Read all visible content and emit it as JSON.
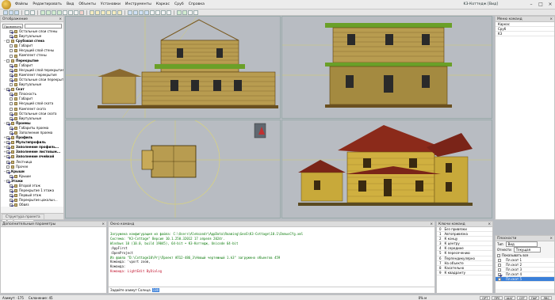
{
  "app": {
    "menu": [
      "Файлы",
      "Редактировать",
      "Вид",
      "Объекты",
      "Установки",
      "Инструменты",
      "Каркас",
      "Сруб",
      "Справка"
    ],
    "doc_title": "K3-Коттедж [Вид]"
  },
  "left_panel": {
    "title": "Отображение",
    "tabs": [
      "Структура проекта",
      "Отображение"
    ],
    "preset": "Применить",
    "tree": [
      {
        "label": "Остальные слои стены",
        "check": true,
        "indent": 2,
        "icon": true
      },
      {
        "label": "Виртуальные",
        "check": true,
        "indent": 2,
        "icon": true
      },
      {
        "label": "Срубовая стена",
        "check": false,
        "indent": 1,
        "icon": true,
        "bold": true,
        "exp": "−"
      },
      {
        "label": "Габарит",
        "check": false,
        "indent": 2,
        "icon": true
      },
      {
        "label": "Несущий слой стены",
        "check": false,
        "indent": 2,
        "icon": true
      },
      {
        "label": "Комплект стены",
        "check": false,
        "indent": 2,
        "icon": true
      },
      {
        "label": "Перекрытие",
        "check": false,
        "indent": 1,
        "icon": true,
        "bold": true,
        "exp": "−"
      },
      {
        "label": "Габарит",
        "check": true,
        "indent": 2,
        "icon": true
      },
      {
        "label": "Несущий слой перекрытия",
        "check": true,
        "indent": 2,
        "icon": true
      },
      {
        "label": "Комплект перекрытия",
        "check": true,
        "indent": 2,
        "icon": true
      },
      {
        "label": "Остальные слои перекрытия",
        "check": true,
        "indent": 2,
        "icon": true
      },
      {
        "label": "Виртуальные",
        "check": false,
        "indent": 2,
        "icon": true
      },
      {
        "label": "Скат",
        "check": true,
        "indent": 1,
        "icon": true,
        "bold": true,
        "exp": "−"
      },
      {
        "label": "Плоскость",
        "check": true,
        "indent": 2,
        "icon": true
      },
      {
        "label": "Габарит",
        "check": false,
        "indent": 2,
        "icon": true
      },
      {
        "label": "Несущий слой ската",
        "check": false,
        "indent": 2,
        "icon": true
      },
      {
        "label": "Комплект ската",
        "check": false,
        "indent": 2,
        "icon": true
      },
      {
        "label": "Остальные слои ската",
        "check": true,
        "indent": 2,
        "icon": true
      },
      {
        "label": "Виртуальные",
        "check": true,
        "indent": 2,
        "icon": true
      },
      {
        "label": "Проемы",
        "check": true,
        "indent": 1,
        "icon": true,
        "bold": true,
        "exp": "−"
      },
      {
        "label": "Габариты проема",
        "check": true,
        "indent": 2,
        "icon": true
      },
      {
        "label": "Заполнение проема",
        "check": true,
        "indent": 2,
        "icon": true
      },
      {
        "label": "Профиль",
        "check": true,
        "indent": 1,
        "icon": true,
        "bold": true,
        "exp": "+"
      },
      {
        "label": "Мультипрофиль",
        "check": true,
        "indent": 1,
        "icon": true,
        "bold": true,
        "exp": "+"
      },
      {
        "label": "Заполнение профиль...",
        "check": true,
        "indent": 1,
        "icon": true,
        "bold": true,
        "exp": "+"
      },
      {
        "label": "Заполнение листовым...",
        "check": true,
        "indent": 1,
        "icon": true,
        "bold": true,
        "exp": "+"
      },
      {
        "label": "Заполнение ячейкой",
        "check": true,
        "indent": 1,
        "icon": true,
        "bold": true,
        "exp": "+"
      },
      {
        "label": "Лестница",
        "check": true,
        "indent": 1,
        "icon": true,
        "exp": ""
      },
      {
        "label": "Прочее",
        "check": false,
        "indent": 1,
        "icon": true,
        "exp": ""
      },
      {
        "label": "Крыши",
        "check": true,
        "indent": 1,
        "icon": false,
        "bold": true,
        "exp": "−"
      },
      {
        "label": "Крыши",
        "check": true,
        "indent": 2,
        "icon": true
      },
      {
        "label": "Этажи",
        "check": true,
        "indent": 1,
        "icon": false,
        "bold": true,
        "exp": "−"
      },
      {
        "label": "Второй этаж",
        "check": true,
        "indent": 2,
        "icon": true
      },
      {
        "label": "Перекрытие 1 этажа",
        "check": true,
        "indent": 2,
        "icon": true
      },
      {
        "label": "Первый этаж",
        "check": true,
        "indent": 2,
        "icon": true
      },
      {
        "label": "Перекрытие цокольн...",
        "check": true,
        "indent": 2,
        "icon": true
      },
      {
        "label": "Обвяз",
        "check": true,
        "indent": 2,
        "icon": true
      }
    ]
  },
  "right_panel": {
    "title": "Меню команд",
    "items": [
      "Каркас",
      "Сруб",
      "K3"
    ]
  },
  "params_panel": {
    "title": "Дополнительные параметры"
  },
  "command_window": {
    "title": "Окно команд",
    "lines": [
      {
        "t": "Загружена конфигурация из файла: C:\\Users\\Aleksandr\\AppData\\Roaming\\GeoS\\K3-Cottage\\10.1\\DomusCfg.xml",
        "c": "c-green"
      },
      {
        "t": "Система: \"K3-Cottage\" Версия 10.1.250.32012  17 апреля 2024г.",
        "c": "c-green"
      },
      {
        "t": "Windows 10 (10.0, build 19045), 64-bit  •  K3-Коттедж, Unicode 64-bit",
        "c": "c-green"
      },
      {
        "t": ":AppFirst",
        "c": "c-blk"
      },
      {
        "t": ":OpenProject",
        "c": "c-blk"
      },
      {
        "t": "Из файла \"D:\\Cottage10\\Prj\\Проект АП12-486_3\\Новый чертежный 1.k3\" загружено объектов 459",
        "c": "c-green"
      },
      {
        "t": "Команда: 'vport zoom,",
        "c": "c-blk"
      },
      {
        "t": "Команда:",
        "c": "c-blk"
      },
      {
        "t": "Команда: LightEdit ByDialog",
        "c": "c-red"
      }
    ],
    "prompt": "Задайте азимут Солнца",
    "input": "180"
  },
  "snap_panel": {
    "title": "Ключи команд",
    "items": [
      {
        "k": "0",
        "t": "Без привязки"
      },
      {
        "k": "1",
        "t": "Автопривязка"
      },
      {
        "k": "2",
        "t": "К концу"
      },
      {
        "k": "3",
        "t": "К центру"
      },
      {
        "k": "4",
        "t": "К середине"
      },
      {
        "k": "5",
        "t": "К пересечению"
      },
      {
        "k": "6",
        "t": "Перпендикулярно"
      },
      {
        "k": "7",
        "t": "На объекте"
      },
      {
        "k": "8",
        "t": "Касательно"
      },
      {
        "k": "9",
        "t": "К квадранту"
      }
    ]
  },
  "layers_panel": {
    "title": "Плоскости",
    "type_label": "Тип",
    "type_value": "Вид",
    "attach_label": "Отнести",
    "attach_value": "Текущая",
    "show_all": "Показывать все",
    "items": [
      {
        "t": "Пл.скат 1",
        "check": false
      },
      {
        "t": "Пл.скат 2",
        "check": false
      },
      {
        "t": "Пл.скат 3",
        "check": false
      },
      {
        "t": "Пл.скат 4",
        "check": true
      },
      {
        "t": "Пл.скат 5",
        "check": false,
        "sel": true
      }
    ]
  },
  "status": {
    "coords": "Азимут: -175",
    "snap": "Склонение: 45",
    "unit": "0% м",
    "buttons": [
      "ОРТ",
      "ПРЕ",
      "ШАГ",
      "СЕТ",
      "ПАР",
      "ЛВС"
    ]
  },
  "colors": {
    "wood": "#c8a93a",
    "roof": "#8b2a1a",
    "viewport_bg": "#b8bcc2",
    "green_cmd": "#0a7a0a"
  }
}
